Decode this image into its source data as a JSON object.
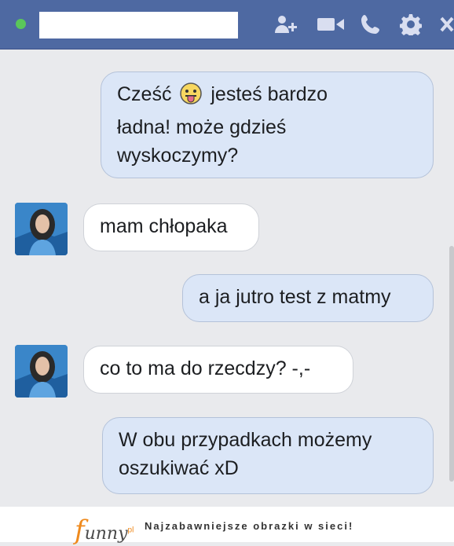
{
  "header": {
    "icons": [
      "add-friend-icon",
      "video-call-icon",
      "phone-icon",
      "gear-icon",
      "close-icon"
    ]
  },
  "messages": [
    {
      "side": "out",
      "lines": [
        "Cześć",
        "jesteś bardzo",
        "ładna! może gdzieś",
        "wyskoczymy?"
      ]
    },
    {
      "side": "in",
      "text": "mam chłopaka"
    },
    {
      "side": "out",
      "text": "a ja jutro test z matmy"
    },
    {
      "side": "in",
      "text": "co to ma do rzecdzy? -,-"
    },
    {
      "side": "out",
      "lines": [
        "W obu przypadkach możemy",
        "oszukiwać xD"
      ]
    }
  ],
  "footer": {
    "logo_text": "unny",
    "logo_suffix": "pl",
    "tagline": "Najzabawniejsze obrazki w sieci!"
  },
  "colors": {
    "header": "#4e69a2",
    "outgoing_bubble": "#dbe6f7",
    "incoming_bubble": "#ffffff",
    "online": "#5ac75a"
  }
}
